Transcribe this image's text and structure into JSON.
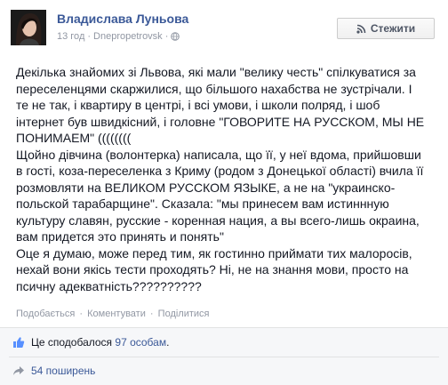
{
  "post": {
    "author": "Владислава Луньова",
    "time": "13 год",
    "separator": "·",
    "location": "Dnepropetrovsk",
    "follow_label": "Стежити",
    "body_lines": [
      "Декілька знайомих зі Львова, які мали \"велику честь\" спілкуватися за",
      "переселенцями скаржилися, що більшого нахабства не зустрічали. І",
      "те не так, і квартиру в центрі, і всі умови, і школи полряд, і шоб",
      "інтернет був швидкісний, і головне \"ГОВОРИТЕ НА РУССКОМ, МЫ НЕ",
      "ПОНИМАЕМ\" ((((((((",
      "Щойно дівчина (волонтерка) написала, що її, у неї вдома, прийшовши",
      "в гості, коза-переселенка з Криму (родом з Донецької області) вчила її",
      "розмовляти на ВЕЛИКОМ РУССКОМ ЯЗЫКЕ, а не на \"украинско-",
      "польской тарабарщине\". Сказала: \"мы принесем вам истиннную",
      "культуру славян, русские - коренная нация, а вы всего-лишь окраина,",
      "вам придется это принять и понять\"",
      "Оце я думаю, може перед тим, як гостинно приймати тих малоросів,",
      "нехай вони якісь тести проходять? Ні, не на знання мови, просто на",
      "псичну адекватність??????????"
    ]
  },
  "actions": {
    "like": "Подобається",
    "comment": "Коментувати",
    "share": "Поділитися",
    "dot": "·"
  },
  "ufi": {
    "likes_prefix": "Це сподобалося ",
    "likes_count": "97 особам",
    "likes_suffix": ".",
    "shares_text": "54 поширень"
  },
  "icons": {
    "follow": "rss-icon",
    "time": "clock-icon",
    "privacy": "globe-icon",
    "likes": "thumbs-up-icon",
    "shares": "share-arrow-icon"
  },
  "colors": {
    "link": "#3b5998",
    "meta": "#9197a3",
    "ufi_bg": "#f6f7f9"
  }
}
